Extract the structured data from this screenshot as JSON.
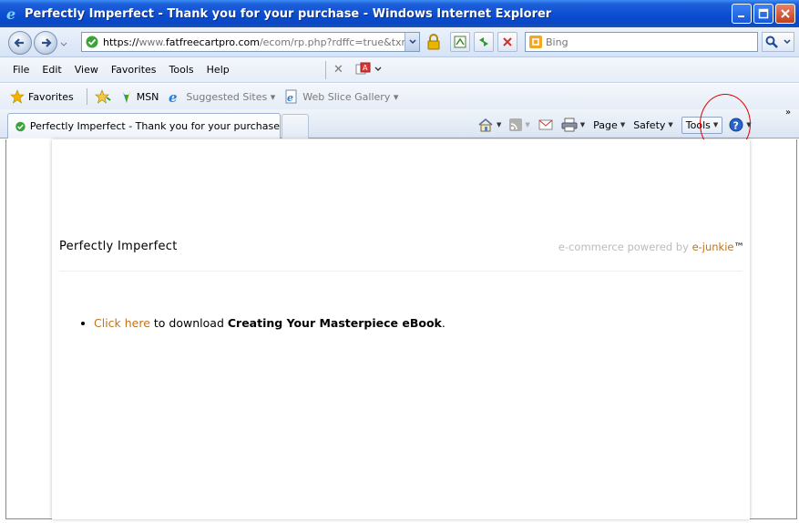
{
  "window": {
    "title": "Perfectly Imperfect - Thank you for your purchase - Windows Internet Explorer"
  },
  "address_bar": {
    "url_prefix": "https://",
    "url_domain_dim1": "www.",
    "url_domain": "fatfreecartpro.com",
    "url_path": "/ecom/rp.php?rdffc=true&txn_id=",
    "search_placeholder": "Bing"
  },
  "menu": {
    "items": [
      "File",
      "Edit",
      "View",
      "Favorites",
      "Tools",
      "Help"
    ]
  },
  "favorites_bar": {
    "favorites_label": "Favorites",
    "msn_label": "MSN",
    "suggested_label": "Suggested Sites ▾",
    "webslice_label": "Web Slice Gallery ▾"
  },
  "tabs": {
    "active_tab": "Perfectly Imperfect - Thank you for your purchase"
  },
  "command_bar": {
    "page_label": "Page",
    "safety_label": "Safety",
    "tools_label": "Tools",
    "chevron": "»"
  },
  "page": {
    "store_title": "Perfectly Imperfect",
    "powered_prefix": "e-commerce powered by ",
    "powered_brand": "e-junkie",
    "powered_tm": "™",
    "download_link": "Click here",
    "download_middle": " to download ",
    "download_product": "Creating Your Masterpiece eBook",
    "download_end": "."
  },
  "colors": {
    "accent_link": "#c0741c",
    "titlebar_blue": "#0a4cd0",
    "highlight_circle": "#dd0000"
  }
}
